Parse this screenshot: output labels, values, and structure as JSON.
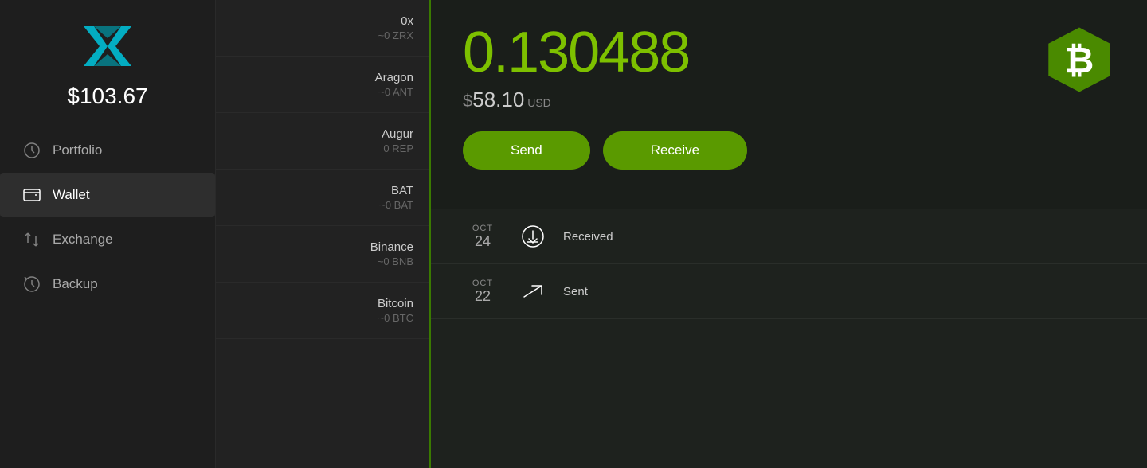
{
  "sidebar": {
    "balance": "$103.67",
    "nav_items": [
      {
        "id": "portfolio",
        "label": "Portfolio",
        "active": false,
        "icon": "clock"
      },
      {
        "id": "wallet",
        "label": "Wallet",
        "active": true,
        "icon": "wallet"
      },
      {
        "id": "exchange",
        "label": "Exchange",
        "active": false,
        "icon": "exchange"
      },
      {
        "id": "backup",
        "label": "Backup",
        "active": false,
        "icon": "backup"
      }
    ]
  },
  "coin_list": {
    "coins": [
      {
        "name": "0x",
        "amount": "~0 ZRX"
      },
      {
        "name": "Aragon",
        "amount": "~0 ANT"
      },
      {
        "name": "Augur",
        "amount": "0 REP"
      },
      {
        "name": "BAT",
        "amount": "~0 BAT"
      },
      {
        "name": "Binance",
        "amount": "~0 BNB"
      },
      {
        "name": "Bitcoin",
        "amount": "~0 BTC"
      }
    ]
  },
  "coin_detail": {
    "coin_name": "Bitcoin",
    "coin_symbol": "BTC",
    "balance": "0.130488",
    "usd_value": "58.10",
    "usd_unit": "USD",
    "send_label": "Send",
    "receive_label": "Receive"
  },
  "transactions": [
    {
      "month": "OCT",
      "day": "24",
      "type": "received",
      "label": "Received"
    },
    {
      "month": "OCT",
      "day": "22",
      "type": "sent",
      "label": "Sent"
    }
  ]
}
